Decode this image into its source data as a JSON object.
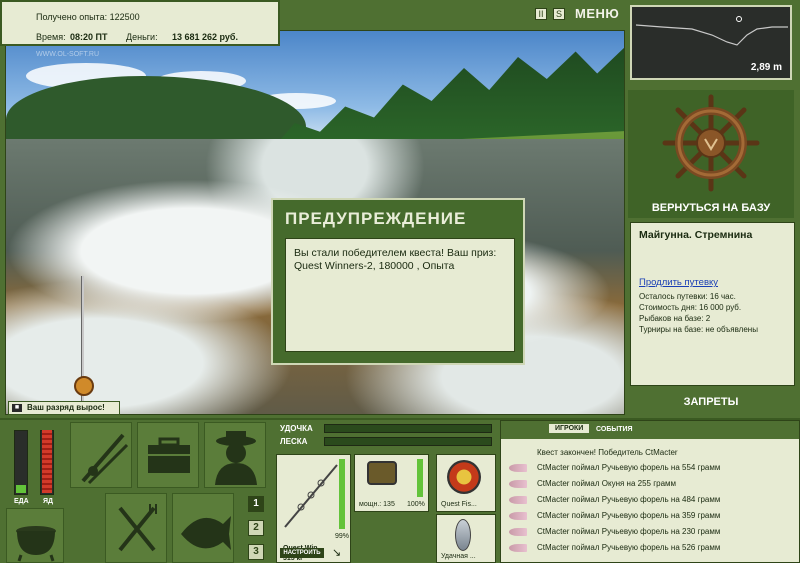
{
  "info": {
    "experience_text": "Получено опыта: 122500",
    "time_label": "Время:",
    "time_value": "08:20 ПТ",
    "money_label": "Деньги:",
    "money_value": "13 681 262 руб."
  },
  "watermark": "WWW.OL-SOFT.RU",
  "toolbar": {
    "pause_label": "II",
    "sound_label": "S",
    "menu_label": "МЕНЮ"
  },
  "depth": {
    "value": "2,89 m"
  },
  "dialog": {
    "title": "ПРЕДУПРЕЖДЕНИЕ",
    "message": "Вы стали победителем квеста! Ваш приз: Quest Winners-2, 180000 , Опыта"
  },
  "rank_message": "Ваш разряд вырос!",
  "base": {
    "back_label": "ВЕРНУТЬСЯ НА БАЗУ",
    "name": "Майгунна. Стремнина",
    "extend_link": "Продлить путевку",
    "lines": [
      "Осталось путевки: 16 час.",
      "Стоимость дня: 16 000 руб.",
      "Рыбаков на базе: 2",
      "Турниры на базе: не объявлены"
    ],
    "bans_label": "ЗАПРЕТЫ"
  },
  "bars": {
    "food_label": "ЕДА",
    "poison_label": "ЯД",
    "food_level": 0.12,
    "poison_level": 1.0
  },
  "nav_numbers": [
    "1",
    "2",
    "3"
  ],
  "tackle": {
    "rod_label": "УДОЧКА",
    "line_label": "ЛЕСКА",
    "rod_name": "Quest Win...",
    "rod_weight": "315 кг",
    "rod_percent": "99%",
    "reel_info": "мощн.: 135",
    "reel_percent": "100%",
    "line_name": "Quest Fis...",
    "lure_name": "Удачная ...",
    "setup_label": "НАСТРОИТЬ"
  },
  "events": {
    "tab_players": "ИГРОКИ",
    "tab_events": "СОБЫТИЯ",
    "quest_line": "Квест закончен! Победитель CtMacter",
    "items": [
      "CtMacter поймал Ручьевую форель на 554 грамм",
      "CtMacter поймал Окуня на 255 грамм",
      "CtMacter поймал Ручьевую форель на 484 грамм",
      "CtMacter поймал Ручьевую форель на 359 грамм",
      "CtMacter поймал Ручьевую форель на 230 грамм",
      "CtMacter поймал Ручьевую форель на 526 грамм"
    ]
  },
  "colors": {
    "panel_bg": "#e7ebd3",
    "frame_green": "#4f7032",
    "dark_green": "#2e4418"
  }
}
